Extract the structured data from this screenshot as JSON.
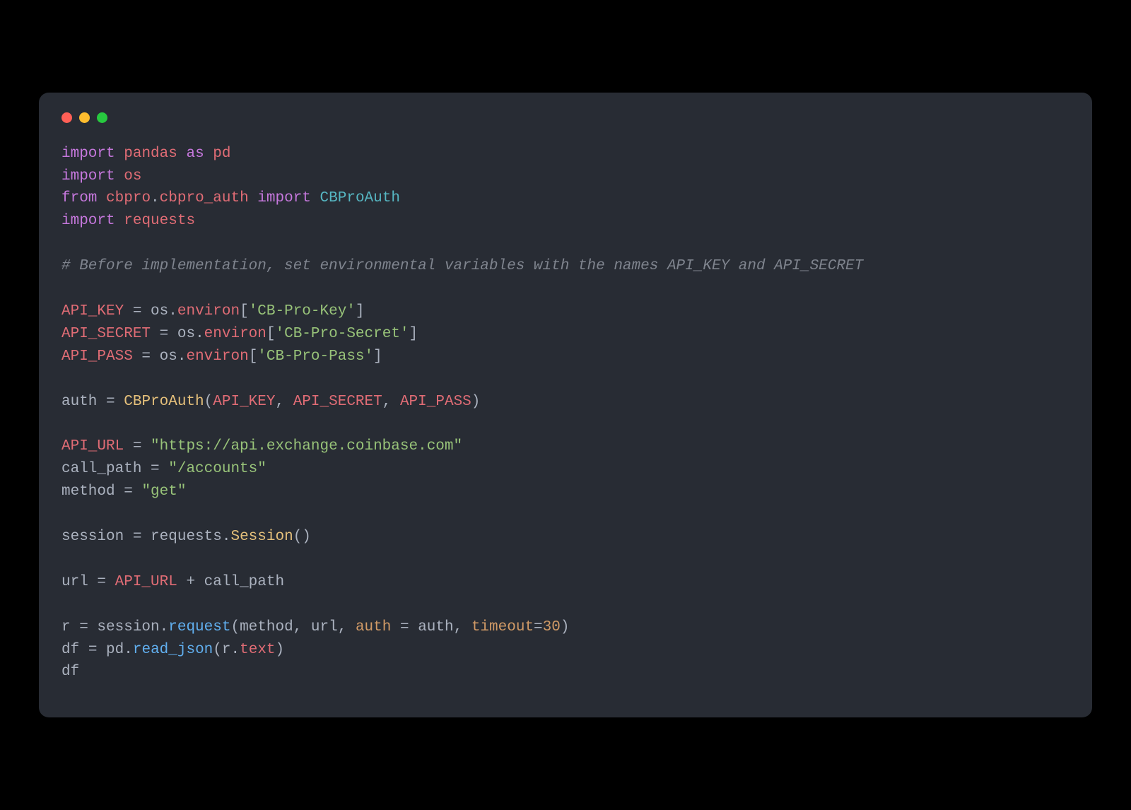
{
  "traffic": {
    "close": "close",
    "minimize": "minimize",
    "zoom": "zoom"
  },
  "code": {
    "l1": {
      "kw1": "import",
      "mod": "pandas",
      "kw2": "as",
      "alias": "pd"
    },
    "l2": {
      "kw1": "import",
      "mod": "os"
    },
    "l3": {
      "kw1": "from",
      "pkg": "cbpro",
      "dot": ".",
      "sub": "cbpro_auth",
      "kw2": "import",
      "cls": "CBProAuth"
    },
    "l4": {
      "kw1": "import",
      "mod": "requests"
    },
    "l6": {
      "comment": "# Before implementation, set environmental variables with the names API_KEY and API_SECRET"
    },
    "l8": {
      "var": "API_KEY",
      "eq": " = ",
      "obj": "os",
      "dot": ".",
      "attr": "environ",
      "lb": "[",
      "str": "'CB-Pro-Key'",
      "rb": "]"
    },
    "l9": {
      "var": "API_SECRET",
      "eq": " = ",
      "obj": "os",
      "dot": ".",
      "attr": "environ",
      "lb": "[",
      "str": "'CB-Pro-Secret'",
      "rb": "]"
    },
    "l10": {
      "var": "API_PASS",
      "eq": " = ",
      "obj": "os",
      "dot": ".",
      "attr": "environ",
      "lb": "[",
      "str": "'CB-Pro-Pass'",
      "rb": "]"
    },
    "l12": {
      "var": "auth",
      "eq": " = ",
      "cls": "CBProAuth",
      "lp": "(",
      "a1": "API_KEY",
      "c1": ", ",
      "a2": "API_SECRET",
      "c2": ", ",
      "a3": "API_PASS",
      "rp": ")"
    },
    "l14": {
      "var": "API_URL",
      "eq": " = ",
      "str": "\"https://api.exchange.coinbase.com\""
    },
    "l15": {
      "var": "call_path",
      "eq": " = ",
      "str": "\"/accounts\""
    },
    "l16": {
      "var": "method",
      "eq": " = ",
      "str": "\"get\""
    },
    "l18": {
      "var": "session",
      "eq": " = ",
      "obj": "requests",
      "dot": ".",
      "fn": "Session",
      "lp": "(",
      "rp": ")"
    },
    "l20": {
      "var": "url",
      "eq": " = ",
      "a1": "API_URL",
      "plus": " + ",
      "a2": "call_path"
    },
    "l22": {
      "var": "r",
      "eq": " = ",
      "obj": "session",
      "dot": ".",
      "fn": "request",
      "lp": "(",
      "a1": "method",
      "c1": ", ",
      "a2": "url",
      "c2": ", ",
      "p1": "auth",
      "pe1": " = ",
      "pv1": "auth",
      "c3": ", ",
      "p2": "timeout",
      "pe2": "=",
      "num": "30",
      "rp": ")"
    },
    "l23": {
      "var": "df",
      "eq": " = ",
      "obj": "pd",
      "dot": ".",
      "fn": "read_json",
      "lp": "(",
      "a1": "r",
      "adot": ".",
      "attr": "text",
      "rp": ")"
    },
    "l24": {
      "var": "df"
    }
  }
}
